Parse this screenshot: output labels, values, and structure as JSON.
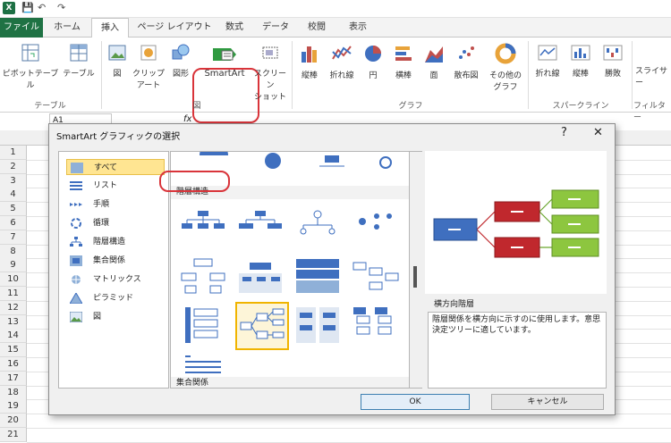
{
  "titlebar": {
    "app_icon": "X",
    "save": "💾",
    "undo": "↶",
    "redo": "↷"
  },
  "tabs": [
    "ファイル",
    "ホーム",
    "挿入",
    "ページ レイアウト",
    "数式",
    "データ",
    "校閲",
    "表示"
  ],
  "ribbon": {
    "pivot": "ピボットテーブル",
    "table": "テーブル",
    "image": "図",
    "clipart": "クリップ",
    "clipart2": "アート",
    "shape": "図形",
    "smartart": "SmartArt",
    "screenshot": "スクリーン",
    "screenshot2": "ショット",
    "col": "縦棒",
    "line": "折れ線",
    "pie": "円",
    "bar": "横棒",
    "area": "面",
    "scatter": "散布図",
    "other": "その他の",
    "other2": "グラフ",
    "sp_line": "折れ線",
    "sp_col": "縦棒",
    "sp_win": "勝敗",
    "slicer": "スライサー",
    "g_table": "テーブル",
    "g_image": "図",
    "g_chart": "グラフ",
    "g_spark": "スパークライン",
    "g_filter": "フィルター"
  },
  "namebox": "A1",
  "fx": "fx",
  "rows": [
    "1",
    "2",
    "3",
    "4",
    "5",
    "6",
    "7",
    "8",
    "9",
    "10",
    "11",
    "12",
    "13",
    "14",
    "15",
    "16",
    "17",
    "18",
    "19",
    "20",
    "21"
  ],
  "dialog": {
    "title": "SmartArt グラフィックの選択",
    "help": "?",
    "close": "✕",
    "categories": [
      {
        "label": "すべて"
      },
      {
        "label": "リスト"
      },
      {
        "label": "手順"
      },
      {
        "label": "循環"
      },
      {
        "label": "階層構造"
      },
      {
        "label": "集合関係"
      },
      {
        "label": "マトリックス"
      },
      {
        "label": "ピラミッド"
      },
      {
        "label": "図"
      }
    ],
    "section_hierarchy": "階層構造",
    "section_relation": "集合関係",
    "preview_name": "横方向階層",
    "description": "階層関係を横方向に示すのに使用します。意思決定ツリーに適しています。",
    "ok": "OK",
    "cancel": "キャンセル"
  },
  "colors": {
    "excel_green": "#1f7244",
    "red_highlight": "#d9343a",
    "blue_box": "#3f6fbf",
    "red_box": "#c0282d",
    "green_box": "#8dc63f"
  }
}
